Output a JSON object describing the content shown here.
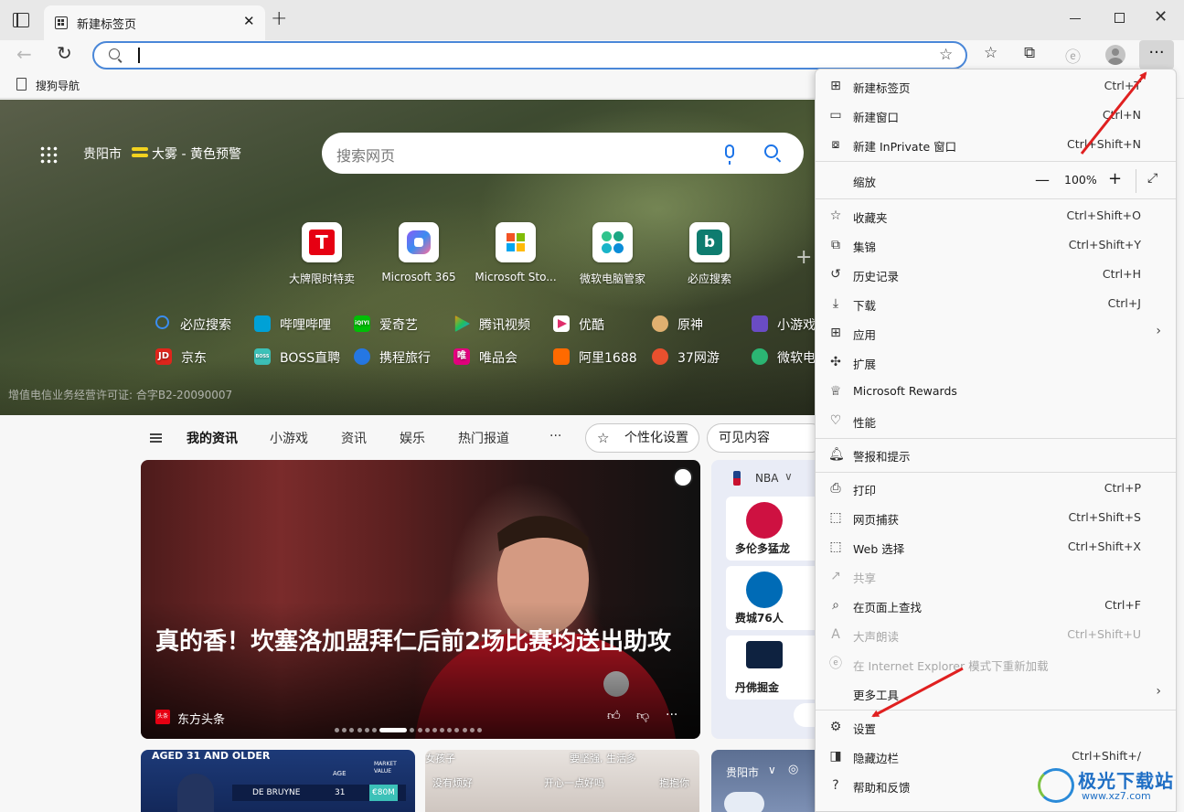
{
  "browser": {
    "tab_title": "新建标签页",
    "tab_close": "✕",
    "new_tab": "+",
    "address_value": "",
    "more_label": "···"
  },
  "favorites_bar": {
    "items": [
      {
        "label": "搜狗导航"
      }
    ]
  },
  "hero": {
    "city": "贵阳市",
    "weather": "大雾 - 黄色预警",
    "search_placeholder": "搜索网页",
    "tiles": [
      {
        "label": "大牌限时特卖",
        "glyph": "T"
      },
      {
        "label": "Microsoft 365"
      },
      {
        "label": "Microsoft Sto..."
      },
      {
        "label": "微软电脑管家"
      },
      {
        "label": "必应搜索",
        "glyph": "b"
      }
    ],
    "add_tile": "+",
    "links_row1": [
      {
        "label": "必应搜索",
        "color": "#1a73e8"
      },
      {
        "label": "哔哩哔哩",
        "color": "#00a1d6"
      },
      {
        "label": "爱奇艺",
        "color": "#00be06",
        "glyph": "iQIYI"
      },
      {
        "label": "腾讯视频",
        "color": "#ff8c00"
      },
      {
        "label": "优酷",
        "color": "#e02e6b"
      },
      {
        "label": "原神",
        "color": "#e0b070"
      },
      {
        "label": "小游戏",
        "color": "#6a4cc4"
      }
    ],
    "links_row2": [
      {
        "label": "京东",
        "color": "#e1251b",
        "glyph": "JD"
      },
      {
        "label": "BOSS直聘",
        "color": "#3cc1b8",
        "glyph": "BOSS"
      },
      {
        "label": "携程旅行",
        "color": "#2577e3"
      },
      {
        "label": "唯品会",
        "color": "#e4007f",
        "glyph": "唯"
      },
      {
        "label": "阿里1688",
        "color": "#ff6a00"
      },
      {
        "label": "37网游",
        "color": "#e8502e"
      },
      {
        "label": "微软电",
        "color": "#2bb673"
      }
    ],
    "license": "增值电信业务经营许可证: 合字B2-20090007"
  },
  "feed_nav": {
    "items": [
      "我的资讯",
      "小游戏",
      "资讯",
      "娱乐",
      "热门报道",
      "···"
    ],
    "personalize": "个性化设置",
    "visible_content": "可见内容"
  },
  "main_card": {
    "headline": "真的香！坎塞洛加盟拜仁后前2场比赛均送出助攻",
    "source": "东方头条",
    "source_logo": "头条",
    "dot_count": 17,
    "active_dot": 6
  },
  "nba_card": {
    "title": "NBA",
    "teams": [
      {
        "name": "多伦多猛龙",
        "color": "#ce1141"
      },
      {
        "name": "费城76人",
        "color": "#006bb6"
      },
      {
        "name": "丹佛掘金",
        "color": "#0e2240"
      }
    ]
  },
  "bottom_cards": {
    "stats_header": "AGED 31 AND OLDER",
    "stats_row": {
      "player": "DE BRUYNE",
      "age": "31",
      "value": "€80M"
    },
    "stats_cols": [
      "AGE",
      "MARKET VALUE"
    ],
    "comic_texts": [
      "女孩子",
      "要坚强, 生活多",
      "没有烦好",
      "开心一点好吗",
      "抱抱你"
    ],
    "weather_city": "贵阳市"
  },
  "menu": {
    "items": [
      {
        "id": "new-tab",
        "icon": "new-tab-icon",
        "label": "新建标签页",
        "shortcut": "Ctrl+T"
      },
      {
        "id": "new-window",
        "icon": "window-icon",
        "label": "新建窗口",
        "shortcut": "Ctrl+N"
      },
      {
        "id": "inprivate",
        "icon": "inprivate-icon",
        "label": "新建 InPrivate 窗口",
        "shortcut": "Ctrl+Shift+N"
      },
      {
        "id": "favorites",
        "icon": "favorites-icon",
        "label": "收藏夹",
        "shortcut": "Ctrl+Shift+O"
      },
      {
        "id": "collections",
        "icon": "collections-icon",
        "label": "集锦",
        "shortcut": "Ctrl+Shift+Y"
      },
      {
        "id": "history",
        "icon": "history-icon",
        "label": "历史记录",
        "shortcut": "Ctrl+H"
      },
      {
        "id": "downloads",
        "icon": "download-icon",
        "label": "下载",
        "shortcut": "Ctrl+J"
      },
      {
        "id": "apps",
        "icon": "apps-icon",
        "label": "应用",
        "shortcut": ""
      },
      {
        "id": "extensions",
        "icon": "puzzle-icon",
        "label": "扩展",
        "shortcut": ""
      },
      {
        "id": "rewards",
        "icon": "trophy-icon",
        "label": "Microsoft Rewards",
        "shortcut": ""
      },
      {
        "id": "performance",
        "icon": "heartbeat-icon",
        "label": "性能",
        "shortcut": ""
      },
      {
        "id": "alerts",
        "icon": "bell-icon",
        "label": "警报和提示",
        "shortcut": ""
      },
      {
        "id": "print",
        "icon": "printer-icon",
        "label": "打印",
        "shortcut": "Ctrl+P"
      },
      {
        "id": "web-capture",
        "icon": "capture-icon",
        "label": "网页捕获",
        "shortcut": "Ctrl+Shift+S"
      },
      {
        "id": "web-select",
        "icon": "select-icon",
        "label": "Web 选择",
        "shortcut": "Ctrl+Shift+X"
      },
      {
        "id": "share",
        "icon": "share-icon",
        "label": "共享",
        "shortcut": ""
      },
      {
        "id": "find",
        "icon": "find-icon",
        "label": "在页面上查找",
        "shortcut": "Ctrl+F"
      },
      {
        "id": "read-aloud",
        "icon": "read-aloud-icon",
        "label": "大声朗读",
        "shortcut": "Ctrl+Shift+U"
      },
      {
        "id": "ie-mode",
        "icon": "ie-icon",
        "label": "在 Internet Explorer 模式下重新加载",
        "shortcut": ""
      },
      {
        "id": "more-tools",
        "icon": "",
        "label": "更多工具",
        "shortcut": ""
      },
      {
        "id": "settings",
        "icon": "gear-icon",
        "label": "设置",
        "shortcut": ""
      },
      {
        "id": "hide-sidebar",
        "icon": "sidebar-icon",
        "label": "隐藏边栏",
        "shortcut": "Ctrl+Shift+/"
      },
      {
        "id": "help",
        "icon": "help-icon",
        "label": "帮助和反馈",
        "shortcut": ""
      }
    ],
    "zoom": {
      "label": "缩放",
      "value": "100%",
      "minus": "—",
      "plus": "+"
    }
  },
  "watermark": {
    "name": "极光下载站",
    "url": "www.xz7.com"
  },
  "colors": {
    "accent": "#1a73e8",
    "annotation": "#e02020"
  }
}
